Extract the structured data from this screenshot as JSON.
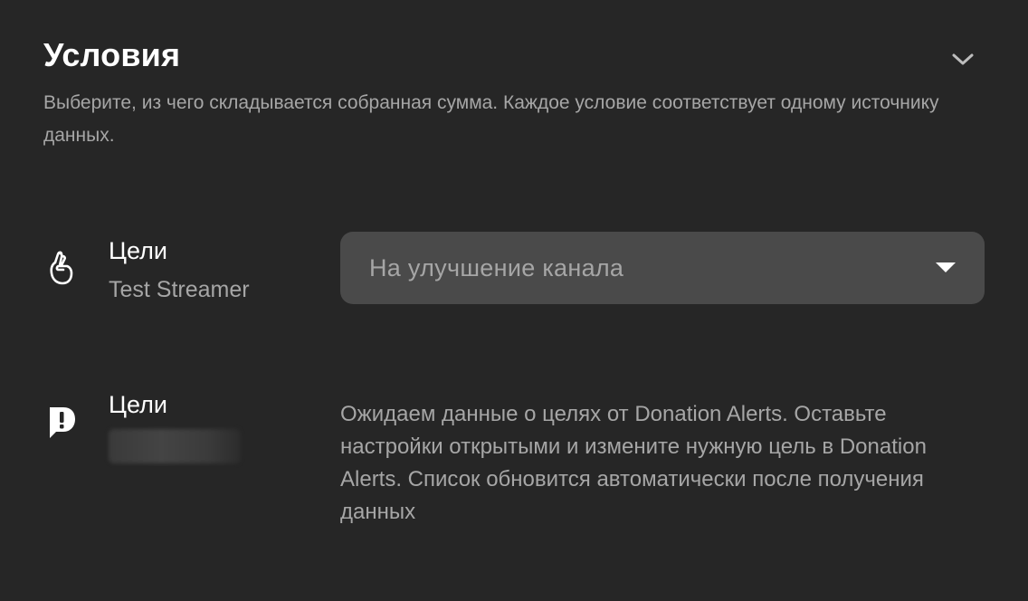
{
  "section": {
    "title": "Условия",
    "description": "Выберите, из чего складывается собранная сумма. Каждое условие соответствует одному источнику данных.",
    "collapse_icon": "chevron-up-down-icon"
  },
  "conditions": [
    {
      "icon": "hand-gesture-icon",
      "title": "Цели",
      "subtitle": "Test Streamer",
      "select": {
        "value": "На улучшение канала",
        "icon": "caret-down-icon"
      }
    },
    {
      "icon": "donation-alerts-icon",
      "title": "Цели",
      "subtitle_blurred": true,
      "info": "Ожидаем данные о целях от Donation Alerts. Оставьте настройки открытыми и измените нужную цель в Donation Alerts. Список обновится автоматически после получения данных"
    }
  ],
  "colors": {
    "background": "#262626",
    "select_background": "#4a4a4a",
    "text_primary": "#ffffff",
    "text_secondary": "#a6a6a6"
  }
}
